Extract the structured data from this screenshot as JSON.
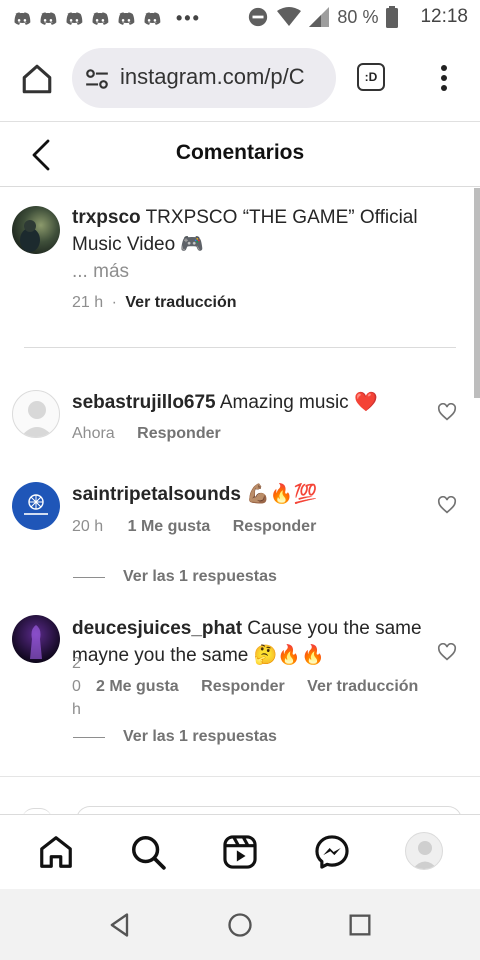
{
  "status_bar": {
    "notifications": [
      "discord-icon",
      "discord-icon",
      "discord-icon",
      "discord-icon",
      "discord-icon",
      "discord-icon"
    ],
    "more_dots": "•••",
    "battery_percent": "80 %",
    "time": "12:18"
  },
  "browser": {
    "url": "instagram.com/p/C",
    "tabs_label": ":D"
  },
  "header": {
    "title": "Comentarios"
  },
  "caption": {
    "username": "trxpsco",
    "text": " TRXPSCO “THE GAME” Official Music Video 🎮",
    "more": "... más",
    "time": "21 h",
    "separator": "·",
    "translate": "Ver traducción"
  },
  "comments": [
    {
      "username": "sebastrujillo675",
      "text": " Amazing music ❤️",
      "time": "Ahora",
      "reply": "Responder"
    },
    {
      "username": "saintripetalsounds",
      "text": " 💪🏽🔥💯",
      "time": "20 h",
      "likes": "1 Me gusta",
      "reply": "Responder",
      "replies": "Ver las 1 respuestas"
    },
    {
      "username": "deucesjuices_phat",
      "text": " Cause you the same mayne you the same 🤔🔥🔥",
      "time_line1": "2",
      "time_line2": "0",
      "time_line3": "h",
      "likes": "2 Me gusta",
      "reply": "Responder",
      "translate": "Ver traducción",
      "replies": "Ver las 1 respuestas"
    }
  ],
  "colors": {
    "accent_heart": "#ed4956",
    "text_primary": "#262626",
    "text_secondary": "#8e8e8e"
  }
}
